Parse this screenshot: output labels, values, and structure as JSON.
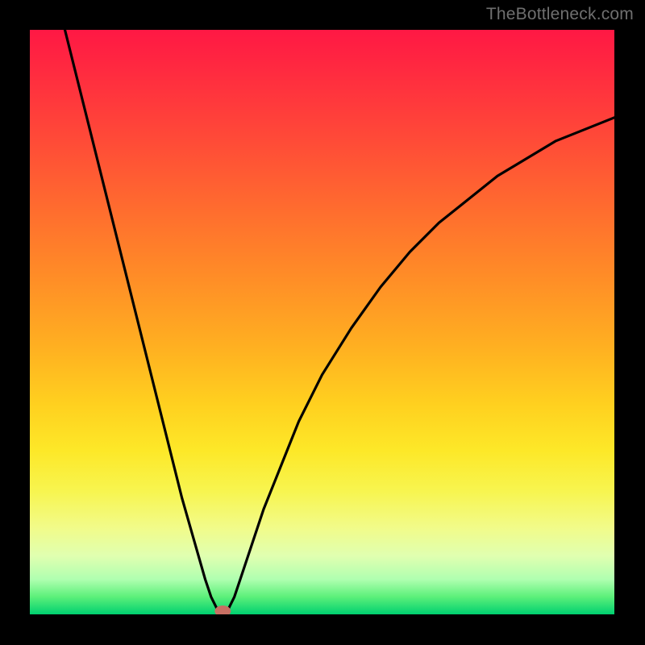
{
  "watermark": {
    "text": "TheBottleneck.com"
  },
  "chart_data": {
    "type": "line",
    "title": "",
    "xlabel": "",
    "ylabel": "",
    "xlim": [
      0,
      100
    ],
    "ylim": [
      0,
      100
    ],
    "grid": false,
    "legend": false,
    "background": {
      "style": "vertical-gradient",
      "stops": [
        {
          "pos": 0,
          "color": "#ff1844"
        },
        {
          "pos": 100,
          "color": "#00d070"
        }
      ],
      "meaning": "top = worst (red), bottom = best (green)"
    },
    "series": [
      {
        "name": "bottleneck-curve",
        "x": [
          6,
          8,
          10,
          12,
          14,
          16,
          18,
          20,
          22,
          24,
          26,
          28,
          30,
          31,
          32,
          33,
          34,
          35,
          36,
          38,
          40,
          42,
          44,
          46,
          48,
          50,
          55,
          60,
          65,
          70,
          75,
          80,
          85,
          90,
          95,
          100
        ],
        "y": [
          100,
          92,
          84,
          76,
          68,
          60,
          52,
          44,
          36,
          28,
          20,
          13,
          6,
          3,
          1,
          0,
          1,
          3,
          6,
          12,
          18,
          23,
          28,
          33,
          37,
          41,
          49,
          56,
          62,
          67,
          71,
          75,
          78,
          81,
          83,
          85
        ]
      }
    ],
    "marker": {
      "name": "optimal-point",
      "x": 33,
      "y": 0,
      "color": "#c86f63"
    }
  }
}
